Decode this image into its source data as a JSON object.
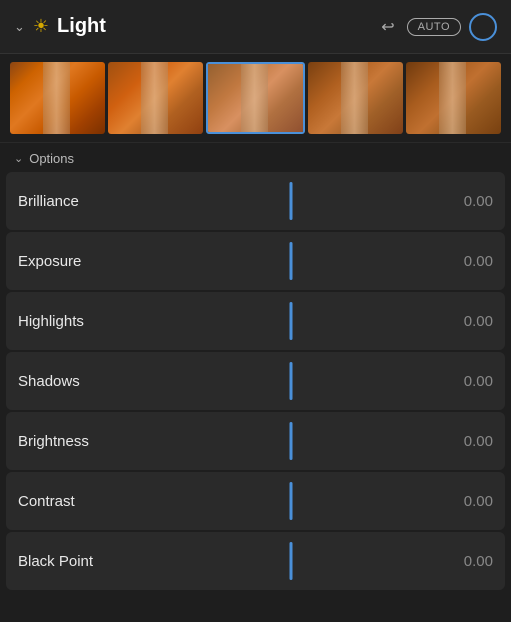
{
  "colors": {
    "accent": "#4a90d9",
    "background": "#1e1e1e",
    "row_bg": "#2a2a2a",
    "text_primary": "#ffffff",
    "text_secondary": "#888888",
    "text_label": "#e8e8e8",
    "text_muted": "#aaaaaa",
    "sun_color": "#d4a800"
  },
  "header": {
    "title": "Light",
    "undo_symbol": "↩",
    "auto_label": "AUTO",
    "chevron_symbol": "∨"
  },
  "options": {
    "label": "Options",
    "chevron_symbol": "∨"
  },
  "sliders": [
    {
      "label": "Brilliance",
      "value": "0.00"
    },
    {
      "label": "Exposure",
      "value": "0.00"
    },
    {
      "label": "Highlights",
      "value": "0.00"
    },
    {
      "label": "Shadows",
      "value": "0.00"
    },
    {
      "label": "Brightness",
      "value": "0.00"
    },
    {
      "label": "Contrast",
      "value": "0.00"
    },
    {
      "label": "Black Point",
      "value": "0.00"
    }
  ],
  "filmstrip": {
    "frames": [
      1,
      2,
      3,
      4,
      5
    ],
    "selected_index": 2
  }
}
